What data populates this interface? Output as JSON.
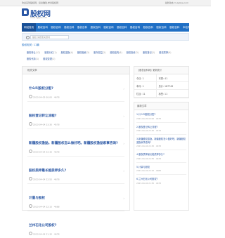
{
  "topbar": {
    "left": "欢迎来到股权网，投资赚钱,参考股权网",
    "right": "最新动态  m.zgliyw.com"
  },
  "logo": {
    "name": "股权网",
    "sub": "www.zglyw.com"
  },
  "nav": [
    "网站首页",
    "股权百科",
    "股权百科",
    "股权百科",
    "股权百科",
    "股权百科",
    "股权百科",
    "股权百科",
    "股权百科",
    "股权百科",
    "股权百科",
    "股权百科",
    "本站导航",
    "联系我们"
  ],
  "search": {
    "placeholder": "股权 请搜索关键词"
  },
  "hot": {
    "label": "股权相关: 11篇"
  },
  "tags": [
    {
      "text": "股权转让",
      "count": "(12)"
    },
    {
      "text": "股权分红",
      "count": "(1)"
    },
    {
      "text": "股权激励",
      "count": "(4)"
    },
    {
      "text": "股权融资",
      "count": "(3)"
    },
    {
      "text": "股东权益",
      "count": "(2)"
    },
    {
      "text": "股权结构",
      "count": "(6)"
    },
    {
      "text": "股权投资",
      "count": "(3)"
    },
    {
      "text": "股权登记",
      "count": "(2)"
    },
    {
      "text": "股权质押",
      "count": "(9)"
    },
    {
      "text": "股权代持",
      "count": "(1)"
    },
    {
      "text": "股权变更",
      "count": "(1)"
    }
  ],
  "list": {
    "head": "相关文章",
    "articles": [
      {
        "title": "什么叫股权分配?",
        "date": "2023-04-05 00:00 · 4678"
      },
      {
        "title": "股权登记转让流程?",
        "date": "2023-04-04 23:30 · 4578"
      },
      {
        "title": "新疆股权激励。新疆股权怎么做好吧。新疆股权激励家事咨询?",
        "date": "2023-04-04 22:30 · 4678"
      },
      {
        "title": "股权质押最长能质押多久?",
        "date": "2023-04-04 22:55 · 4678"
      },
      {
        "title": "计量与股权",
        "date": "2023-04-04 22:15 · 4688"
      },
      {
        "title": "兰州石化公司股权?",
        "date": "2023-04-04 21:30 · 4678"
      }
    ]
  },
  "stats": {
    "head": "【股权百科网】更新统计",
    "rows": [
      [
        "今日: 1",
        "本周: 41"
      ],
      [
        "本月: 1",
        "总计: 187749"
      ],
      [
        "栏目: 11",
        "标签: 11"
      ]
    ]
  },
  "recommend": {
    "head": "最新文章",
    "items": [
      {
        "title": "1.什么叫股权分配?",
        "date": "2023-04-05 00:00 · 4678"
      },
      {
        "title": "2.股权登记转让流程?",
        "date": "2023-04-04 23:30 · 4578"
      },
      {
        "title": "3.新疆股权激励。新疆股权怎么做好吧。新疆股权激励家事咨询?",
        "date": "2023-04-04 22:30 · 4678"
      },
      {
        "title": "4.股权质押最长能质押多久?",
        "date": "2023-04-04 22:55 · 4678"
      },
      {
        "title": "5.计量与股权",
        "date": "2023-04-04 22:15 · 4688"
      },
      {
        "title": "6.兰州石化公司股权?",
        "date": "2023-04-04 21:30 · 4678"
      }
    ]
  }
}
